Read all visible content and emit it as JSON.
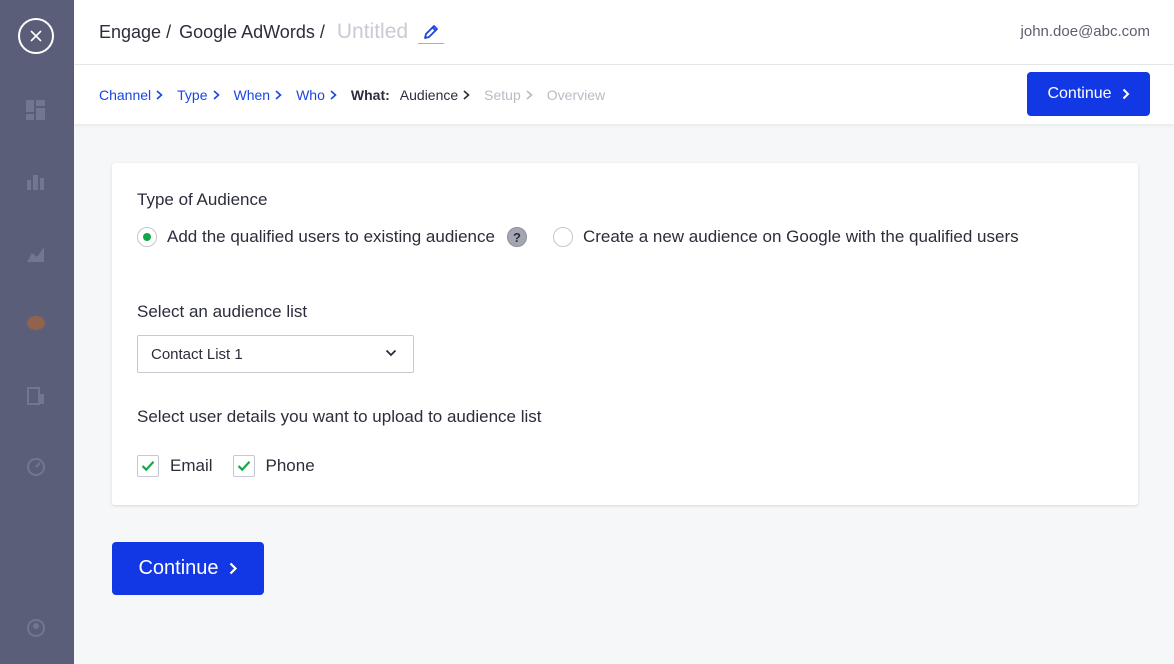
{
  "close_icon": "close-icon",
  "header": {
    "breadcrumb": [
      "Engage",
      "Google AdWords"
    ],
    "title": "Untitled",
    "edit_icon": "pencil-icon",
    "user_email": "john.doe@abc.com"
  },
  "steps": {
    "items": [
      "Channel",
      "Type",
      "When",
      "Who"
    ],
    "active_label": "What:",
    "current": "Audience",
    "disabled": [
      "Setup",
      "Overview"
    ],
    "continue_label": "Continue"
  },
  "form": {
    "audience_type_label": "Type of Audience",
    "options": [
      {
        "label": "Add the qualified users to existing audience",
        "selected": true
      },
      {
        "label": "Create a new audience on Google with the qualified users",
        "selected": false
      }
    ],
    "help_icon": "?",
    "list_label": "Select an audience list",
    "list_value": "Contact List 1",
    "details_label": "Select user details you want to upload to audience list",
    "details": [
      {
        "label": "Email",
        "checked": true
      },
      {
        "label": "Phone",
        "checked": true
      }
    ]
  },
  "footer": {
    "continue_label": "Continue"
  },
  "colors": {
    "primary": "#1238e6",
    "success": "#12a84a",
    "link": "#1a46e0"
  }
}
